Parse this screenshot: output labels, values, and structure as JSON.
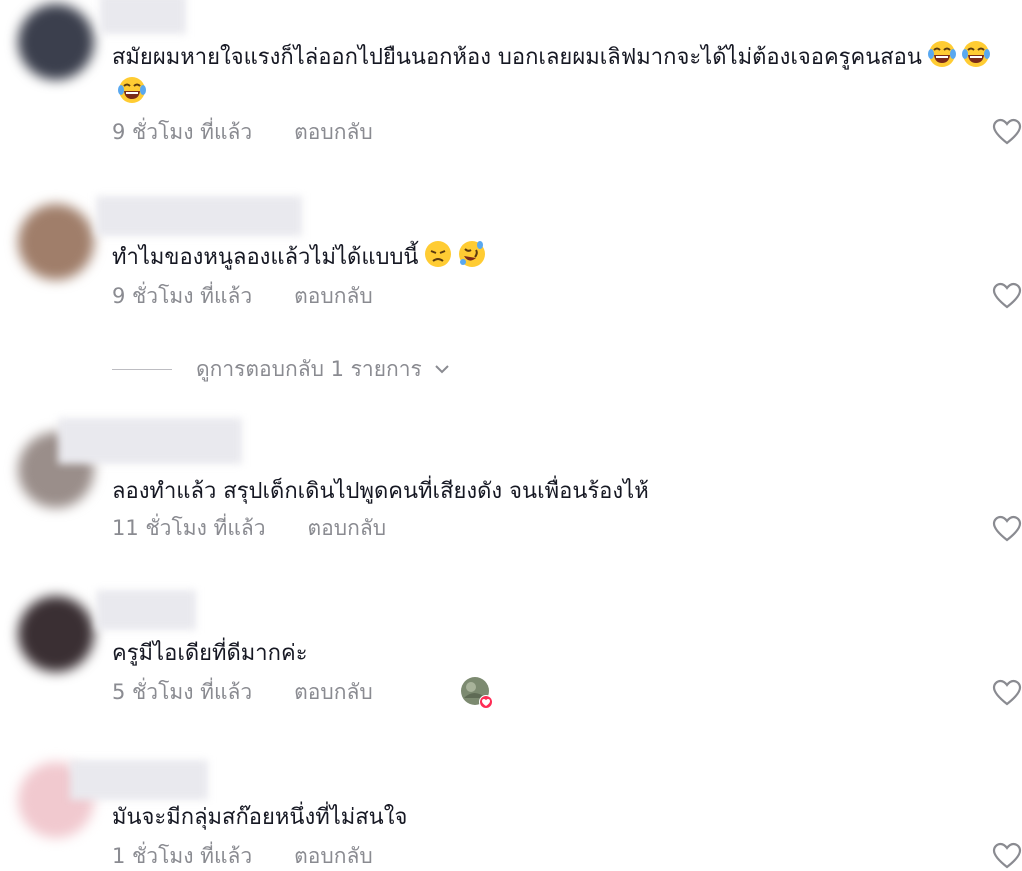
{
  "comments": [
    {
      "text": "สมัยผมหายใจแรงก็ไล่ออกไปยืนนอกห้อง บอกเลยผมเลิฟมากจะได้ไม่ต้องเจอครูคนสอน",
      "emojis": [
        "tears-of-joy-emoji",
        "tears-of-joy-emoji",
        "tears-of-joy-emoji"
      ],
      "time": "9 ชั่วโมง ที่แล้ว",
      "reply": "ตอบกลับ",
      "avatar_color": "#3b3f4d"
    },
    {
      "text": "ทำไมของหนูลองแล้วไม่ได้แบบนี้",
      "emojis": [
        "disappointed-emoji",
        "rolling-on-floor-laughing-emoji"
      ],
      "time": "9 ชั่วโมง ที่แล้ว",
      "reply": "ตอบกลับ",
      "avatar_color": "#a07e6a"
    },
    {
      "text": "ลองทำแล้ว สรุปเด็กเดินไปพูดคนที่เสียงดัง จนเพื่อนร้องไห้",
      "time": "11 ชั่วโมง ที่แล้ว",
      "reply": "ตอบกลับ",
      "avatar_color": "#9a8e8a"
    },
    {
      "text": "ครูมีไอเดียที่ดีมากค่ะ",
      "time": "5 ชั่วโมง ที่แล้ว",
      "reply": "ตอบกลับ",
      "creator_liked": true,
      "avatar_color": "#3a2f33"
    },
    {
      "text": "มันจะมีกลุ่มสก๊อยหนึ่งที่ไม่สนใจ",
      "time": "1 ชั่วโมง ที่แล้ว",
      "reply": "ตอบกลับ",
      "avatar_color": "#f1c9cf"
    }
  ],
  "view_replies": {
    "label": "ดูการตอบกลับ 1 รายการ"
  },
  "colors": {
    "text": "#161823",
    "meta": "#8a8b91",
    "heart": "#8a8b91",
    "badge": "#fe2c55"
  }
}
